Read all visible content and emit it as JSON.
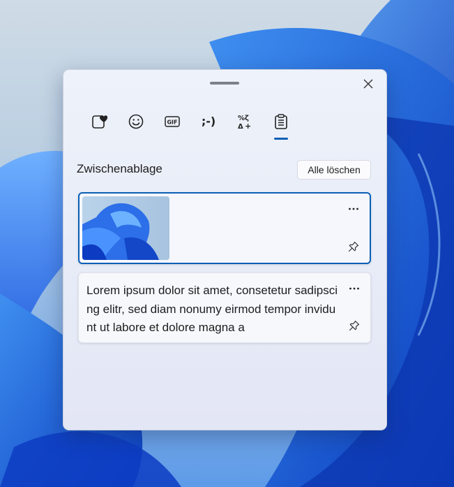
{
  "panel": {
    "tabs": [
      {
        "name": "kaomoji-favorites",
        "icon": "heart-note-icon"
      },
      {
        "name": "emoji",
        "icon": "smiley-icon"
      },
      {
        "name": "gif",
        "label": "GIF"
      },
      {
        "name": "kaomoji",
        "label": ";-)"
      },
      {
        "name": "symbols",
        "icon": "symbols-icon"
      },
      {
        "name": "clipboard",
        "icon": "clipboard-icon",
        "selected": true
      }
    ],
    "section_title": "Zwischenablage",
    "clear_all_label": "Alle löschen",
    "items": [
      {
        "type": "image",
        "selected": true
      },
      {
        "type": "text",
        "text": "Lorem ipsum dolor sit amet, consetetur sadipscing elitr, sed diam nonumy eirmod tempor invidunt ut labore et dolore magna a"
      }
    ]
  },
  "colors": {
    "accent": "#0a5fb5"
  }
}
